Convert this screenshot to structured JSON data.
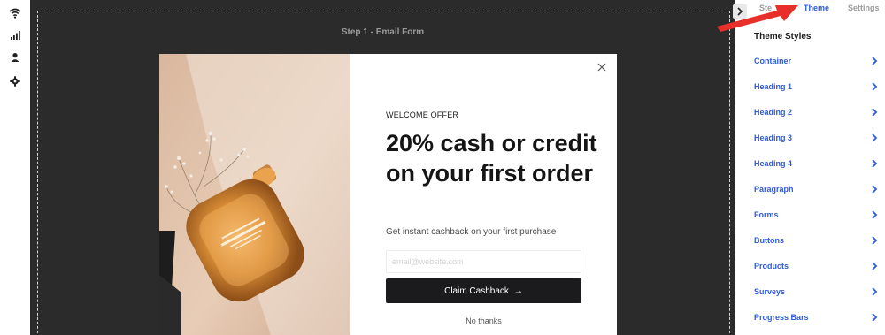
{
  "canvas": {
    "step_title": "Step 1 - Email Form"
  },
  "popup": {
    "eyebrow": "WELCOME OFFER",
    "headline": "20% cash or credit on your first order",
    "subtext": "Get instant cashback on your first purchase",
    "email_placeholder": "email@website.com",
    "claim_label": "Claim Cashback",
    "claim_arrow": "→",
    "no_thanks": "No thanks"
  },
  "panel": {
    "tabs": [
      {
        "label": "Ste"
      },
      {
        "label": "Theme"
      },
      {
        "label": "Settings"
      }
    ],
    "active_tab": "Theme",
    "title": "Theme Styles",
    "items": [
      {
        "label": "Container"
      },
      {
        "label": "Heading 1"
      },
      {
        "label": "Heading 2"
      },
      {
        "label": "Heading 3"
      },
      {
        "label": "Heading 4"
      },
      {
        "label": "Paragraph"
      },
      {
        "label": "Forms"
      },
      {
        "label": "Buttons"
      },
      {
        "label": "Products"
      },
      {
        "label": "Surveys"
      },
      {
        "label": "Progress Bars"
      }
    ]
  },
  "rail": {
    "icons": [
      "wifi-icon",
      "analytics-icon",
      "user-icon",
      "gear-icon"
    ]
  },
  "colors": {
    "accent": "#2f5bd6",
    "canvas_bg": "#2b2b2b",
    "button_bg": "#1b1b1d",
    "annotation": "#e8302a"
  }
}
